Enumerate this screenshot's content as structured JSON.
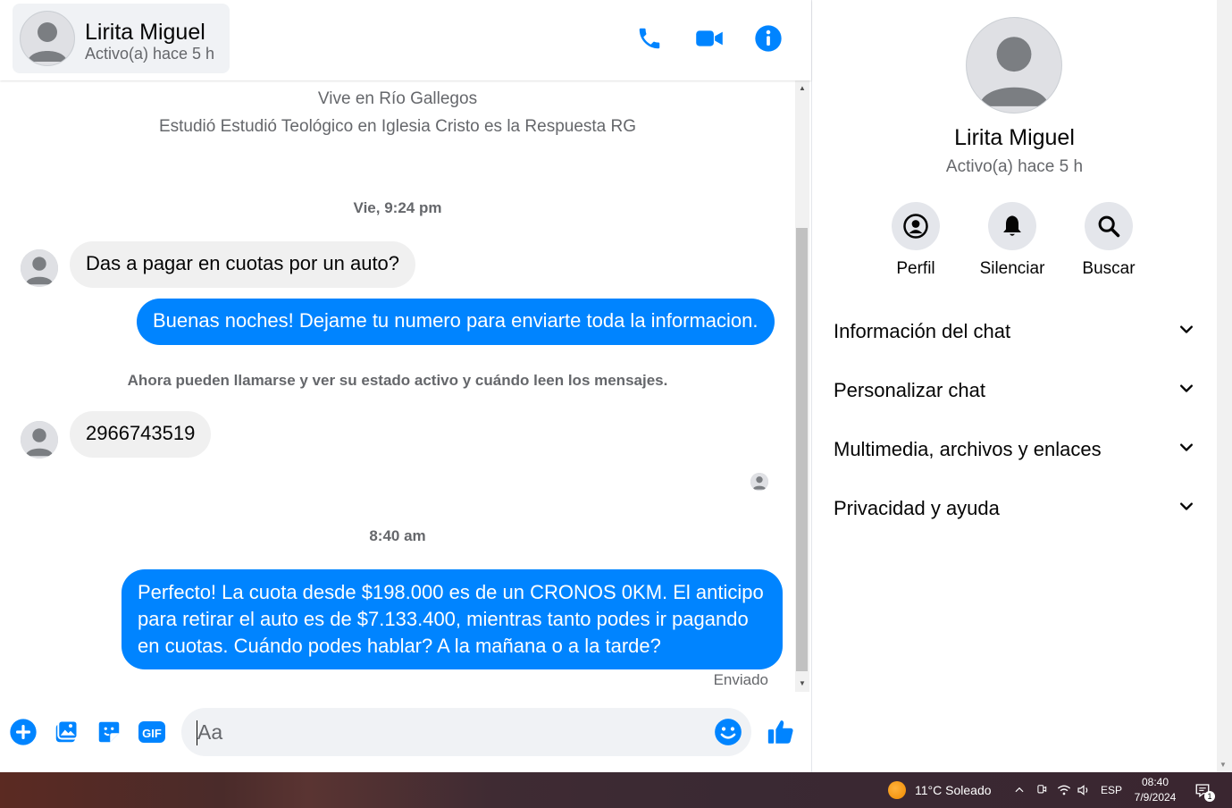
{
  "header": {
    "contact_name": "Lirita Miguel",
    "contact_status": "Activo(a) hace 5 h",
    "icons": [
      "phone-icon",
      "video-call-icon",
      "info-icon"
    ]
  },
  "intro": {
    "line1": "Vive en Río Gallegos",
    "line2": "Estudió Estudió Teológico en Iglesia Cristo es la Respuesta RG"
  },
  "conversation": {
    "timestamp1": "Vie, 9:24 pm",
    "msg1": "Das a pagar en cuotas por un auto?",
    "msg2": "Buenas noches! Dejame tu numero para enviarte toda la informacion.",
    "system_note": "Ahora pueden llamarse y ver su estado activo y cuándo leen los mensajes.",
    "msg3": "2966743519",
    "timestamp2": "8:40 am",
    "msg4": "Perfecto! La cuota desde $198.000 es de un CRONOS 0KM. El anticipo para retirar el auto es de $7.133.400, mientras tanto podes ir pagando en cuotas. Cuándo podes hablar? A la mañana o a la tarde?",
    "sent_label": "Enviado"
  },
  "composer": {
    "placeholder": "Aa",
    "icons": [
      "add-icon",
      "image-icon",
      "sticker-icon",
      "gif-icon",
      "emoji-icon",
      "like-icon"
    ],
    "gif_label": "GIF"
  },
  "side_panel": {
    "name": "Lirita Miguel",
    "status": "Activo(a) hace 5 h",
    "actions": [
      {
        "label": "Perfil",
        "icon": "profile-icon"
      },
      {
        "label": "Silenciar",
        "icon": "bell-icon"
      },
      {
        "label": "Buscar",
        "icon": "search-icon"
      }
    ],
    "sections": [
      {
        "title": "Información del chat"
      },
      {
        "title": "Personalizar chat"
      },
      {
        "title": "Multimedia, archivos y enlaces"
      },
      {
        "title": "Privacidad y ayuda"
      }
    ]
  },
  "taskbar": {
    "weather": "11°C  Soleado",
    "language": "ESP",
    "time": "08:40",
    "date": "7/9/2024",
    "notification_count": "1"
  },
  "colors": {
    "accent": "#0084ff",
    "bubble_in": "#f0f0f0",
    "muted_text": "#65676b"
  }
}
